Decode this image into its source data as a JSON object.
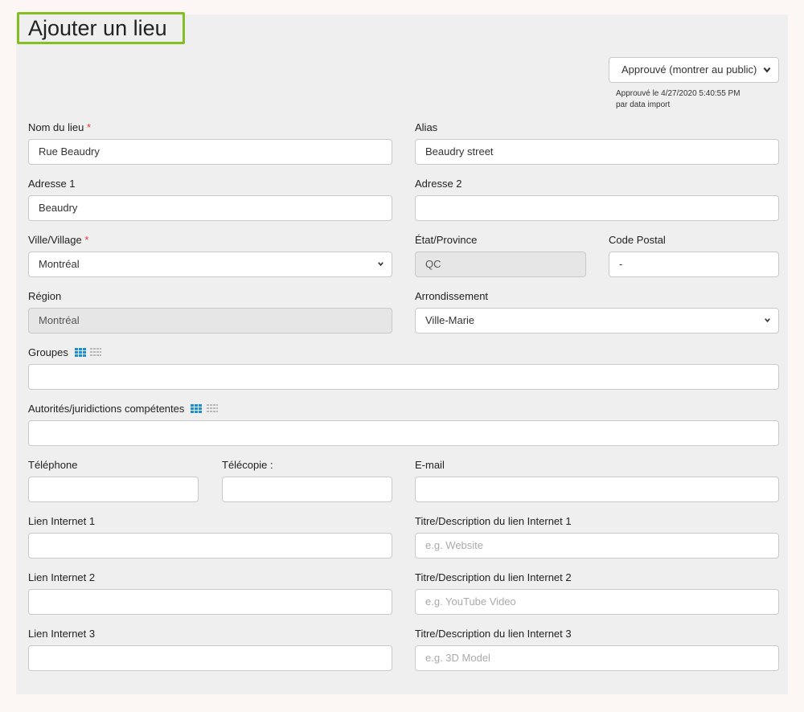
{
  "page": {
    "title": "Ajouter un lieu"
  },
  "status": {
    "selected": "Approuvé (montrer au public)",
    "approved_line": "Approuvé le 4/27/2020 5:40:55 PM",
    "by_line": "par data import"
  },
  "fields": {
    "nom": {
      "label": "Nom du lieu",
      "required": "*",
      "value": "Rue Beaudry"
    },
    "alias": {
      "label": "Alias",
      "value": "Beaudry street"
    },
    "adresse1": {
      "label": "Adresse 1",
      "value": "Beaudry"
    },
    "adresse2": {
      "label": "Adresse 2",
      "value": ""
    },
    "ville": {
      "label": "Ville/Village",
      "required": "*",
      "value": "Montréal"
    },
    "etat": {
      "label": "État/Province",
      "value": "QC"
    },
    "code_postal": {
      "label": "Code Postal",
      "value": "-"
    },
    "region": {
      "label": "Région",
      "value": "Montréal"
    },
    "arrondissement": {
      "label": "Arrondissement",
      "value": "Ville-Marie"
    },
    "groupes": {
      "label": "Groupes",
      "value": ""
    },
    "autorites": {
      "label": "Autorités/juridictions compétentes",
      "value": ""
    },
    "telephone": {
      "label": "Téléphone",
      "value": ""
    },
    "telecopie": {
      "label": "Télécopie :",
      "value": ""
    },
    "email": {
      "label": "E-mail",
      "value": ""
    },
    "lien1": {
      "label": "Lien Internet 1",
      "value": ""
    },
    "titre1": {
      "label": "Titre/Description du lien Internet 1",
      "placeholder": "e.g. Website"
    },
    "lien2": {
      "label": "Lien Internet 2",
      "value": ""
    },
    "titre2": {
      "label": "Titre/Description du lien Internet 2",
      "placeholder": "e.g. YouTube Video"
    },
    "lien3": {
      "label": "Lien Internet 3",
      "value": ""
    },
    "titre3": {
      "label": "Titre/Description du lien Internet 3",
      "placeholder": "e.g. 3D Model"
    }
  },
  "icons": {
    "grid_view": "grid-view-icon",
    "list_view": "list-view-icon",
    "chevron": "chevron-down-icon"
  },
  "colors": {
    "accent_border": "#86bd22",
    "required": "#e53935",
    "grid_active": "#1a8fd6",
    "grid_inactive": "#b8b8b8"
  }
}
